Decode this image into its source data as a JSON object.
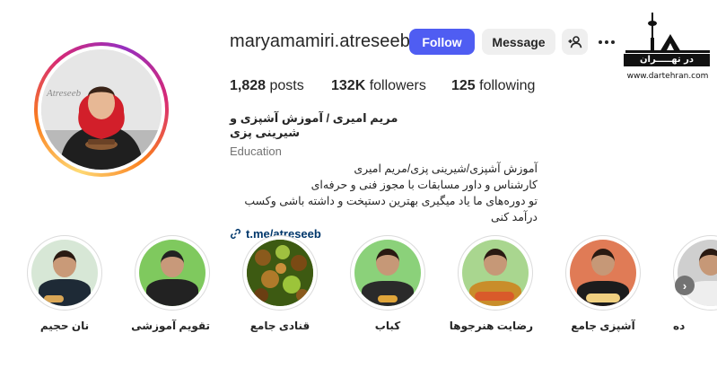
{
  "profile": {
    "username": "maryamamiri.atreseeb",
    "follow_label": "Follow",
    "message_label": "Message",
    "avatar_text": "Atreseeb"
  },
  "stats": {
    "posts_count": "1,828",
    "posts_label": "posts",
    "followers_count": "132K",
    "followers_label": "followers",
    "following_count": "125",
    "following_label": "following"
  },
  "bio": {
    "name": "مریم امیری / آموزش آشپزی و شیرینی پزی",
    "category": "Education",
    "lines": [
      "آموزش آشپزی/شیرینی پزی/مریم امیری",
      "کارشناس و داور مسابقات با مجوز فنی و حرفه‌ای",
      "تو دوره‌های ما یاد میگیری بهترین دستپخت و داشته باشی وکسب درآمد کنی"
    ],
    "link": "t.me/atreseeb"
  },
  "watermark": {
    "band_text": "در تهـــــران",
    "url": "www.dartehran.com"
  },
  "highlights": [
    {
      "label": "نان حجیم",
      "bg": "#d7e7d6",
      "jacket": "#1e2a36"
    },
    {
      "label": "تقویم آموزشی",
      "bg": "#7fc95e",
      "jacket": "#222"
    },
    {
      "label": "قنادی جامع",
      "bg": "#5a7a22",
      "jacket": "#8a5a1c"
    },
    {
      "label": "کباب",
      "bg": "#8bd17a",
      "jacket": "#2a2a2a"
    },
    {
      "label": "رضایت هنرجوها",
      "bg": "#a9d68f",
      "jacket": "#c98d2a"
    },
    {
      "label": "آشپزی جامع",
      "bg": "#e07b56",
      "jacket": "#1c1c1c"
    },
    {
      "label": "ده",
      "bg": "#cfcfcf",
      "jacket": "#eeeeee"
    }
  ],
  "colors": {
    "follow_button": "#4f5df2",
    "secondary_button": "#efefef",
    "link": "#00376b",
    "text": "#262626",
    "muted": "#737373"
  }
}
